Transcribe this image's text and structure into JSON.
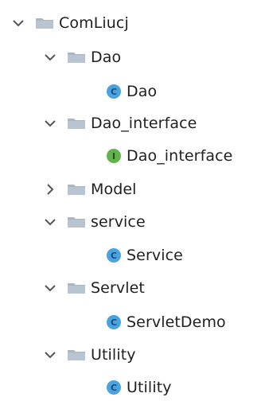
{
  "tree": {
    "root": {
      "label": "ComLiucj",
      "expanded": true,
      "icon": "folder-icon"
    },
    "dao": {
      "label": "Dao",
      "expanded": true,
      "icon": "folder-icon"
    },
    "dao_class": {
      "label": "Dao",
      "badge": "C",
      "icon": "class-icon"
    },
    "dao_interface": {
      "label": "Dao_interface",
      "expanded": true,
      "icon": "folder-icon"
    },
    "dao_interface_item": {
      "label": "Dao_interface",
      "badge": "I",
      "icon": "interface-icon"
    },
    "model": {
      "label": "Model",
      "expanded": false,
      "icon": "folder-icon"
    },
    "service": {
      "label": "service",
      "expanded": true,
      "icon": "folder-icon"
    },
    "service_class": {
      "label": "Service",
      "badge": "C",
      "icon": "class-icon"
    },
    "servlet": {
      "label": "Servlet",
      "expanded": true,
      "icon": "folder-icon"
    },
    "servlet_class": {
      "label": "ServletDemo",
      "badge": "C",
      "icon": "class-icon"
    },
    "utility": {
      "label": "Utility",
      "expanded": true,
      "icon": "folder-icon"
    },
    "utility_class": {
      "label": "Utility",
      "badge": "C",
      "icon": "class-icon"
    }
  },
  "colors": {
    "folder": "#a9b6c4",
    "chevron": "#555555",
    "class_badge": "#4aa3df",
    "interface_badge": "#62b34c"
  }
}
